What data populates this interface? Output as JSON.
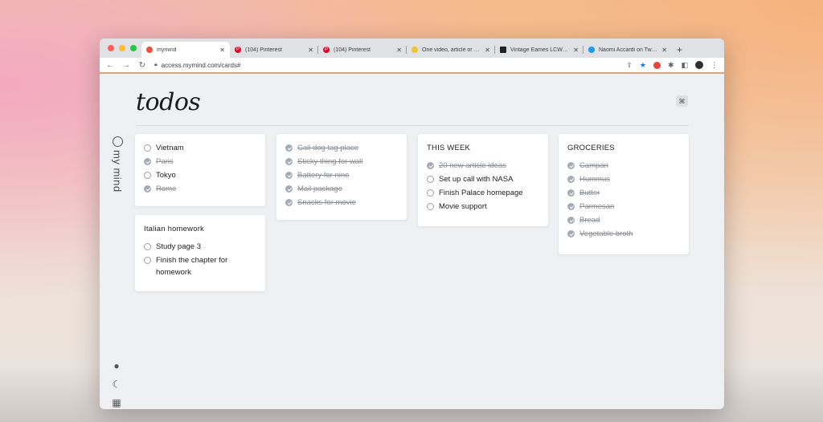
{
  "browser": {
    "tabs": [
      {
        "title": "mymind",
        "favicon": "mymind-icon",
        "color": "#e8533a",
        "active": true
      },
      {
        "title": "(104) Pinterest",
        "favicon": "pinterest-icon",
        "color": "#e60023",
        "active": false
      },
      {
        "title": "(104) Pinterest",
        "favicon": "pinterest-icon",
        "color": "#e60023",
        "active": false
      },
      {
        "title": "One video, article or sid",
        "favicon": "banana-icon",
        "color": "#f4c430",
        "active": false
      },
      {
        "title": "Vintage Eames LCW 'lo",
        "favicon": "square-logo-icon",
        "color": "#222222",
        "active": false
      },
      {
        "title": "Naomi Accardi on Twitte",
        "favicon": "twitter-icon",
        "color": "#1d9bf0",
        "active": false
      }
    ],
    "url": "access.mymind.com/cards#"
  },
  "app": {
    "brand": "my mind",
    "page_title": "todos",
    "cmd_label": "⌘"
  },
  "cards": [
    {
      "title": "",
      "items": [
        {
          "text": "Vietnam",
          "done": false
        },
        {
          "text": "Paris",
          "done": true
        },
        {
          "text": "Tokyo",
          "done": false
        },
        {
          "text": "Rome",
          "done": true
        }
      ]
    },
    {
      "title": "Italian homework",
      "items": [
        {
          "text": "Study page 3",
          "done": false
        },
        {
          "text": "Finish the chapter for homework",
          "done": false
        }
      ]
    },
    {
      "title": "",
      "items": [
        {
          "text": "Call dog tag place",
          "done": true
        },
        {
          "text": "Sticky thing for wall",
          "done": true
        },
        {
          "text": "Battery for nino",
          "done": true
        },
        {
          "text": "Mail package",
          "done": true
        },
        {
          "text": "Snacks for movie",
          "done": true
        }
      ]
    },
    {
      "title": "THIS WEEK",
      "items": [
        {
          "text": "20 new article ideas",
          "done": true
        },
        {
          "text": "Set up call with NASA",
          "done": false
        },
        {
          "text": "Finish Palace homepage",
          "done": false
        },
        {
          "text": "Movie support",
          "done": false
        }
      ]
    },
    {
      "title": "GROCERIES",
      "items": [
        {
          "text": "Campari",
          "done": true
        },
        {
          "text": "Hummus",
          "done": true
        },
        {
          "text": "Butter",
          "done": true
        },
        {
          "text": "Parmesan",
          "done": true
        },
        {
          "text": "Bread",
          "done": true
        },
        {
          "text": "Vegetable broth",
          "done": true
        }
      ]
    }
  ]
}
